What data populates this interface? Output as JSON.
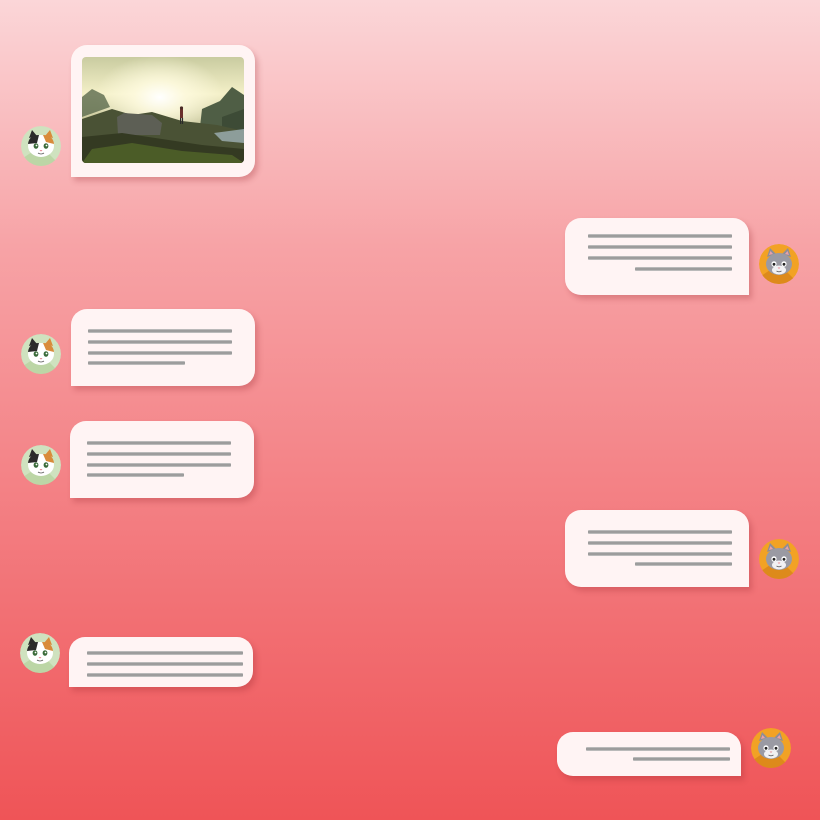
{
  "chat": {
    "theme": {
      "background_top": "#fbd6d8",
      "background_bottom": "#ef5457",
      "bubble_color": "#fff4f4",
      "left_avatar_bg": "#cfe2bf",
      "right_avatar_bg": "#f2a224"
    },
    "participants": {
      "left": {
        "avatar_icon": "calico-cat-icon"
      },
      "right": {
        "avatar_icon": "gray-cat-icon"
      }
    },
    "messages": [
      {
        "sender": "left",
        "type": "image",
        "image_icon": "mountain-sunset-photo"
      },
      {
        "sender": "right",
        "type": "text",
        "text_line_count": 4
      },
      {
        "sender": "left",
        "type": "text",
        "text_line_count": 4
      },
      {
        "sender": "left",
        "type": "text",
        "text_line_count": 4
      },
      {
        "sender": "right",
        "type": "text",
        "text_line_count": 4
      },
      {
        "sender": "left",
        "type": "text",
        "text_line_count": 3
      },
      {
        "sender": "right",
        "type": "text",
        "text_line_count": 2
      }
    ]
  }
}
